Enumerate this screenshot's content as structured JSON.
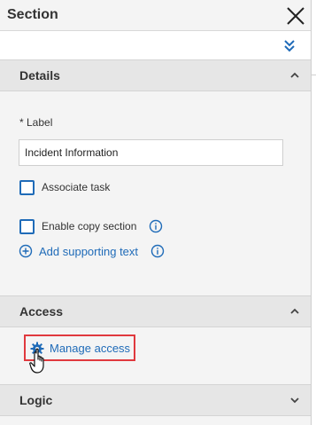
{
  "header": {
    "title": "Section"
  },
  "details": {
    "title": "Details",
    "label_field": {
      "label": "* Label",
      "value": "Incident Information"
    },
    "associate_task": {
      "label": "Associate task",
      "checked": false
    },
    "enable_copy": {
      "label": "Enable copy section",
      "checked": false
    },
    "add_supporting_text": "Add supporting text"
  },
  "access": {
    "title": "Access",
    "manage_access": "Manage access"
  },
  "logic": {
    "title": "Logic"
  },
  "colors": {
    "link": "#1f6bb8",
    "highlight_border": "#e0393e",
    "section_header": "#e6e6e6"
  },
  "icons": [
    "close-icon",
    "double-chevron-down-icon",
    "chevron-up-icon",
    "chevron-down-icon",
    "info-icon",
    "plus-circle-icon",
    "gear-icon",
    "hand-cursor-icon"
  ]
}
